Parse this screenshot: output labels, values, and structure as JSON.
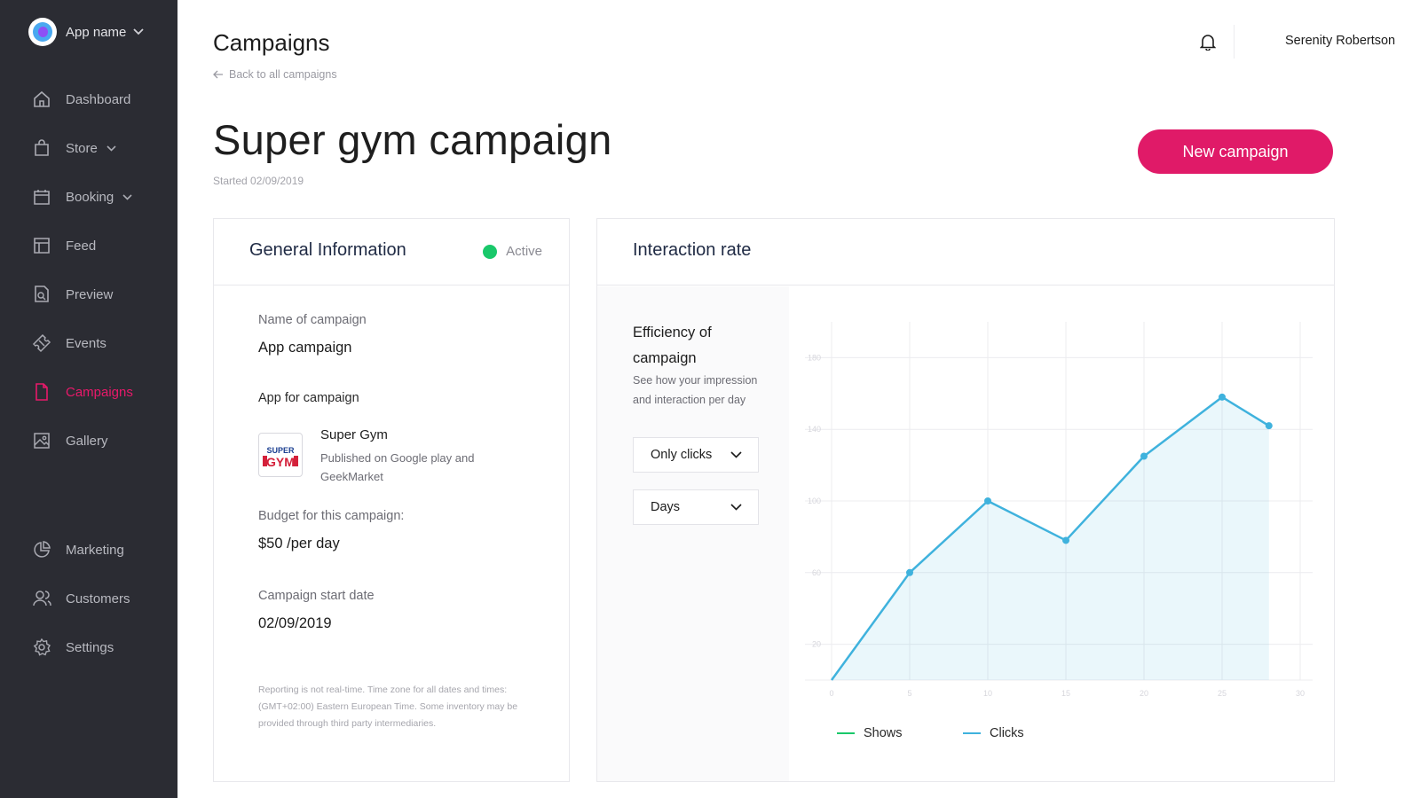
{
  "app": {
    "name": "App name"
  },
  "sidebar": {
    "items": [
      {
        "label": "Dashboard",
        "icon": "home-icon"
      },
      {
        "label": "Store",
        "icon": "bag-icon",
        "expandable": true
      },
      {
        "label": "Booking",
        "icon": "calendar-icon",
        "expandable": true
      },
      {
        "label": "Feed",
        "icon": "layout-icon"
      },
      {
        "label": "Preview",
        "icon": "document-search-icon"
      },
      {
        "label": "Events",
        "icon": "ticket-icon"
      },
      {
        "label": "Campaigns",
        "icon": "file-icon",
        "active": true
      },
      {
        "label": "Gallery",
        "icon": "image-icon"
      },
      {
        "label": "Marketing",
        "icon": "pie-chart-icon"
      },
      {
        "label": "Customers",
        "icon": "users-icon"
      },
      {
        "label": "Settings",
        "icon": "gear-icon"
      }
    ]
  },
  "header": {
    "title": "Campaigns",
    "back_label": "Back to all campaigns",
    "user_name": "Serenity Robertson"
  },
  "campaign": {
    "title": "Super gym campaign",
    "started": "Started 02/09/2019",
    "new_button": "New campaign"
  },
  "general": {
    "title": "General Information",
    "status": "Active",
    "name_label": "Name of campaign",
    "name_value": "App campaign",
    "app_label": "App for campaign",
    "app_name": "Super Gym",
    "app_published": "Published on Google play and GeekMarket",
    "app_logo_text": "SUPER GYM",
    "budget_label": "Budget for this campaign:",
    "budget_value": "$50 /per day",
    "start_label": "Campaign start date",
    "start_value": "02/09/2019",
    "note": "Reporting is not real-time. Time zone for all dates and times: (GMT+02:00) Eastern European Time. Some inventory may be provided through third party intermediaries."
  },
  "interaction": {
    "title": "Interaction rate",
    "efficiency_title": "Efficiency of campaign",
    "efficiency_sub": "See how your impression and interaction per day",
    "filter_value": "Only clicks",
    "period_value": "Days"
  },
  "colors": {
    "accent": "#e01a68",
    "active_status": "#19c86a",
    "clicks": "#3fb2dd",
    "shows": "#19c86a"
  },
  "chart_data": {
    "type": "area",
    "x": [
      0,
      5,
      10,
      15,
      20,
      25,
      28
    ],
    "series": [
      {
        "name": "Clicks",
        "values": [
          0,
          60,
          100,
          78,
          125,
          158,
          142
        ]
      }
    ],
    "legend": [
      "Shows",
      "Clicks"
    ],
    "x_ticks": [
      "0",
      "5",
      "10",
      "15",
      "20",
      "25",
      "30"
    ],
    "y_ticks": [
      "20",
      "60",
      "100",
      "140",
      "180"
    ],
    "xlim": [
      0,
      30
    ],
    "ylim": [
      0,
      200
    ],
    "grid": true
  }
}
